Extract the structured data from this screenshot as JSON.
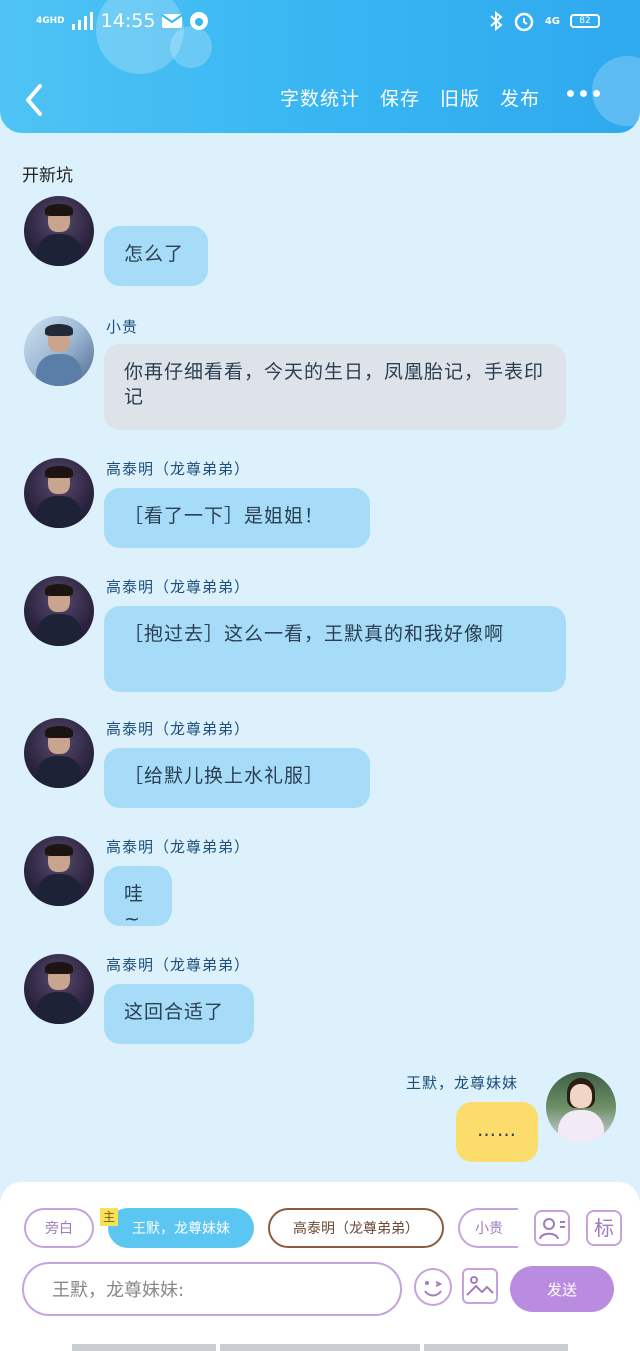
{
  "status_bar": {
    "network": "4GHD",
    "time": "14:55",
    "right_network": "4G",
    "battery": "82"
  },
  "nav": {
    "actions": [
      "字数统计",
      "保存",
      "旧版",
      "发布"
    ],
    "more_label": "更多"
  },
  "chat": {
    "title": "开新坑"
  },
  "messages": [
    {
      "name": "高泰明（龙尊弟弟）",
      "text": "怎么了",
      "style": "blue"
    },
    {
      "name": "小贵",
      "text": "你再仔细看看，今天的生日，凤凰胎记，手表印记",
      "style": "gray"
    },
    {
      "name": "高泰明（龙尊弟弟）",
      "text": "［看了一下］是姐姐！",
      "style": "blue"
    },
    {
      "name": "高泰明（龙尊弟弟）",
      "text": "［抱过去］这么一看，王默真的和我好像啊",
      "style": "blue"
    },
    {
      "name": "高泰明（龙尊弟弟）",
      "text": "［给默儿换上水礼服］",
      "style": "blue"
    },
    {
      "name": "高泰明（龙尊弟弟）",
      "text": "哇~",
      "style": "blue"
    },
    {
      "name": "高泰明（龙尊弟弟）",
      "text": "这回合适了",
      "style": "blue"
    },
    {
      "name": "王默，龙尊妹妹",
      "text": "……",
      "style": "yellow"
    }
  ],
  "roles": {
    "narration": "旁白",
    "main_badge": "主",
    "active": "王默，龙尊妹妹",
    "gao": "高泰明（龙尊弟弟）",
    "xiaogui": "小贵",
    "tag_label": "标"
  },
  "composer": {
    "input_value": "王默，龙尊妹妹:",
    "send_label": "发送"
  },
  "colors": {
    "header": "#38b6f2",
    "page_bg": "#dcf1fb",
    "bubble_blue": "#a6dcf7",
    "bubble_gray": "#dee3ea",
    "bubble_yellow": "#fcdc6a",
    "send_button": "#b98ce0",
    "accent_purple": "#c6a3dc"
  }
}
